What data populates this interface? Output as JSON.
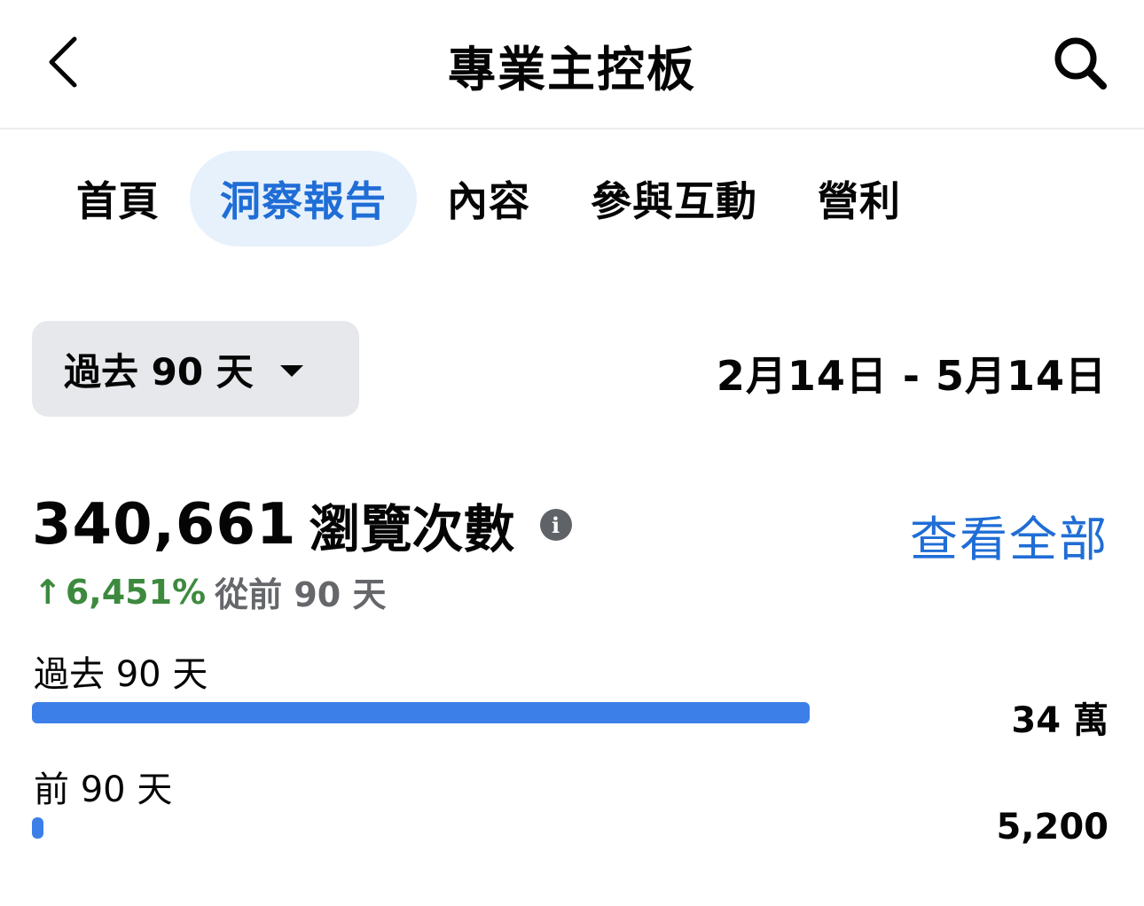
{
  "header": {
    "title": "專業主控板"
  },
  "tabs": [
    {
      "label": "首頁",
      "active": false
    },
    {
      "label": "洞察報告",
      "active": true
    },
    {
      "label": "內容",
      "active": false
    },
    {
      "label": "參與互動",
      "active": false
    },
    {
      "label": "營利",
      "active": false
    }
  ],
  "filter": {
    "range_label": "過去 90 天",
    "date_range": "2月14日 - 5月14日"
  },
  "metric": {
    "value": "340,661",
    "label": "瀏覽次數",
    "see_all": "查看全部",
    "change_arrow": "↑",
    "change_value": "6,451%",
    "change_suffix": "從前 90 天"
  },
  "comparison": [
    {
      "label": "過去 90 天",
      "value_text": "34 萬",
      "value": 340661
    },
    {
      "label": "前 90 天",
      "value_text": "5,200",
      "value": 5200
    }
  ],
  "colors": {
    "accent": "#1f6dd6",
    "bar": "#3c7fe8",
    "positive": "#3d8a3f",
    "tab_active_bg": "#e7f1fc"
  },
  "icons": {
    "back": "chevron-left-icon",
    "search": "search-icon",
    "info": "info-icon",
    "dropdown": "caret-down-icon"
  }
}
